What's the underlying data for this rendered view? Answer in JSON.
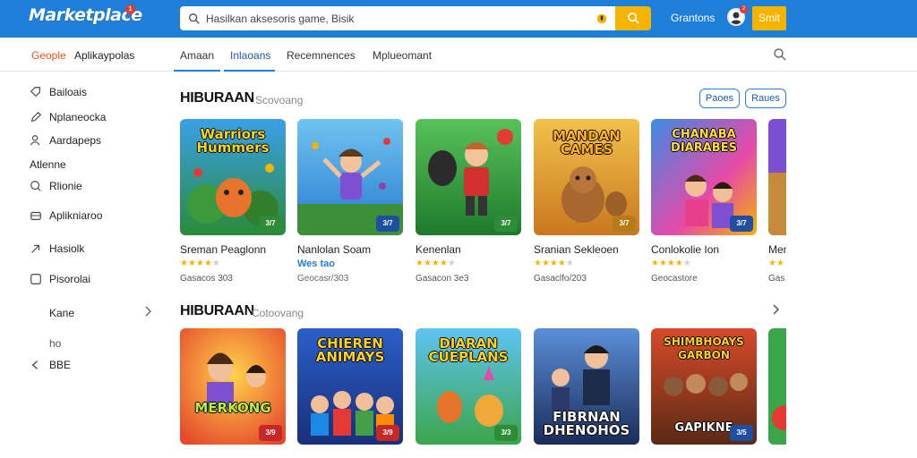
{
  "header": {
    "logo": "Marketplace",
    "logo_badge": "1",
    "search_value": "Hasilkan aksesoris game, Bisik",
    "top_link": "Grantons",
    "avatar_badge": "2",
    "signin_label": "Smit",
    "colors": {
      "bar": "#1e7fd8",
      "accent": "#f5b400"
    }
  },
  "subnav": {
    "brand_red": "Geople",
    "brand_rest": "Aplikaypolas",
    "tabs": [
      "Amaan",
      "Inlaoans",
      "Recemnences",
      "Mplueomant"
    ]
  },
  "sidebar": {
    "items": [
      {
        "label": "Bailoais",
        "icon": "tag-icon"
      },
      {
        "label": "Nplaneocka",
        "icon": "pen-icon"
      },
      {
        "label": "Aardapeps",
        "icon": "user-icon"
      }
    ],
    "heading": "Atlenne",
    "items2": [
      {
        "label": "Rlionie",
        "icon": "search-circle-icon"
      },
      {
        "label": "Aplikniaroo",
        "icon": "box-icon"
      },
      {
        "label": "Hasiolk",
        "icon": "arrow-up-right-icon"
      },
      {
        "label": "Pisorolai",
        "icon": "square-icon"
      }
    ],
    "kane": "Kane",
    "ho": "ho",
    "bottom": "BBE"
  },
  "section1": {
    "title": "HIBURAAN",
    "subtitle": "Scovoang",
    "pill1": "Paoes",
    "pill2": "Raues",
    "cards": [
      {
        "art_title": "Warriors Hummers",
        "name": "Sreman Peaglonn",
        "stars": 4,
        "price": "Gasacos 303",
        "tag": "3/7",
        "tag_color": "#2e8b3a"
      },
      {
        "art_title": "",
        "name": "Nanlolan Soam",
        "stars": 0,
        "price": "Wes tao",
        "price_blue": true,
        "meta": "Geocasr/303",
        "tag": "3/7",
        "tag_color": "#1f4fa0"
      },
      {
        "art_title": "",
        "name": "Kenenlan",
        "stars": 4,
        "price": "Gasacon 3e3",
        "tag": "3/7",
        "tag_color": "#2e8b3a"
      },
      {
        "art_title": "MANDAN CAMES",
        "name": "Sranian Sekleoen",
        "stars": 4,
        "price": "Gasaclfo/203",
        "tag": "3/7",
        "tag_color": "#b67c1a"
      },
      {
        "art_title": "CHANABA DIARABES",
        "name": "Conlokolie Ion",
        "stars": 4,
        "price": "Geocastore",
        "tag": "3/7",
        "tag_color": "#1f4fa0"
      },
      {
        "art_title": "",
        "name": "Men",
        "stars": 4,
        "price": "Gas",
        "tag": "",
        "tag_color": "#1f4fa0"
      }
    ]
  },
  "section2": {
    "title": "HIBURAAN",
    "subtitle": "Cotoovang",
    "cards": [
      {
        "art_title": "MERKONG",
        "tag": "3/9",
        "tag_color": "#c62828"
      },
      {
        "art_title": "CHIEREN ANIMAYS",
        "tag": "3/9",
        "tag_color": "#c62828"
      },
      {
        "art_title": "DIARAN CUEPLANS",
        "tag": "3/3",
        "tag_color": "#2e8b3a"
      },
      {
        "art_title": "FIBRNAN DHENOHOS",
        "tag": "",
        "tag_color": "#1f4fa0"
      },
      {
        "art_title": "SHIMBHOAYS GARBON",
        "art_bottom": "GAPIKNE",
        "tag": "3/5",
        "tag_color": "#1f4fa0"
      },
      {
        "art_title": "",
        "tag": "",
        "tag_color": "#c62828"
      }
    ]
  }
}
